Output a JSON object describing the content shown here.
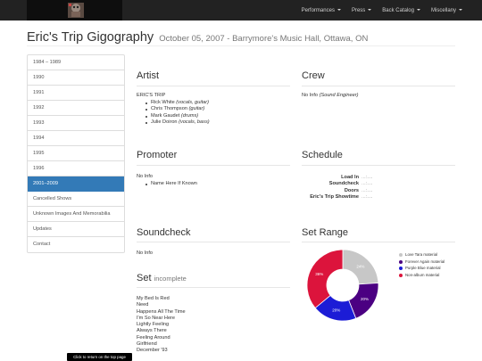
{
  "nav": {
    "items": [
      "Performances",
      "Press",
      "Back Catalog",
      "Miscellany"
    ]
  },
  "header": {
    "title": "Eric's Trip Gigography",
    "subtitle": "October 05, 2007 - Barrymore's Music Hall, Ottawa, ON"
  },
  "sidebar": {
    "items": [
      {
        "label": "1984 – 1989"
      },
      {
        "label": "1990"
      },
      {
        "label": "1991"
      },
      {
        "label": "1992"
      },
      {
        "label": "1993"
      },
      {
        "label": "1994"
      },
      {
        "label": "1995"
      },
      {
        "label": "1996"
      },
      {
        "label": "2001–2009"
      },
      {
        "label": "Cancelled Shows"
      },
      {
        "label": "Unknown Images And Memorabilia"
      },
      {
        "label": "Updates"
      },
      {
        "label": "Contact"
      }
    ],
    "active_index": 8
  },
  "artist": {
    "heading": "Artist",
    "band": "ERIC'S TRIP",
    "members": [
      {
        "name": "Rick White",
        "role": "(vocals, guitar)"
      },
      {
        "name": "Chris Thompson",
        "role": "(guitar)"
      },
      {
        "name": "Mark Gaudet",
        "role": "(drums)"
      },
      {
        "name": "Julie Doiron",
        "role": "(vocals, bass)"
      }
    ]
  },
  "crew": {
    "heading": "Crew",
    "text": "No Info",
    "role": "(Sound Engineer)"
  },
  "promoter": {
    "heading": "Promoter",
    "text": "No Info",
    "item": "Name Here If Known"
  },
  "schedule": {
    "heading": "Schedule",
    "rows": [
      {
        "label": "Load In",
        "value": "...:...."
      },
      {
        "label": "Soundcheck",
        "value": "...:...."
      },
      {
        "label": "Doors",
        "value": "...:...."
      },
      {
        "label": "Eric's Trip Showtime",
        "value": "...:...."
      }
    ]
  },
  "soundcheck": {
    "heading": "Soundcheck",
    "text": "No Info"
  },
  "setrange": {
    "heading": "Set Range"
  },
  "set": {
    "heading": "Set",
    "note": "incomplete",
    "songs": [
      "My Bed Is Red",
      "Need",
      "Happens All The Time",
      "I'm So Near Here",
      "Lightly Feeling",
      "Always There",
      "Feeling Around",
      "Girlfriend",
      "December '93"
    ]
  },
  "tooltip": "Click to return on the top page",
  "colors": {
    "navbar": "#222222",
    "active": "#337ab7"
  },
  "chart_data": {
    "type": "pie",
    "categories": [
      "Love Tara material",
      "Forever Again material",
      "Purple Blue material",
      "Non-album material"
    ],
    "values": [
      24,
      20,
      20,
      36
    ],
    "value_labels": [
      "24%",
      "20%",
      "20%",
      "36%"
    ],
    "colors": [
      "#c7c7c7",
      "#4b0082",
      "#1c1cd6",
      "#dc143c"
    ],
    "legend": "right"
  }
}
